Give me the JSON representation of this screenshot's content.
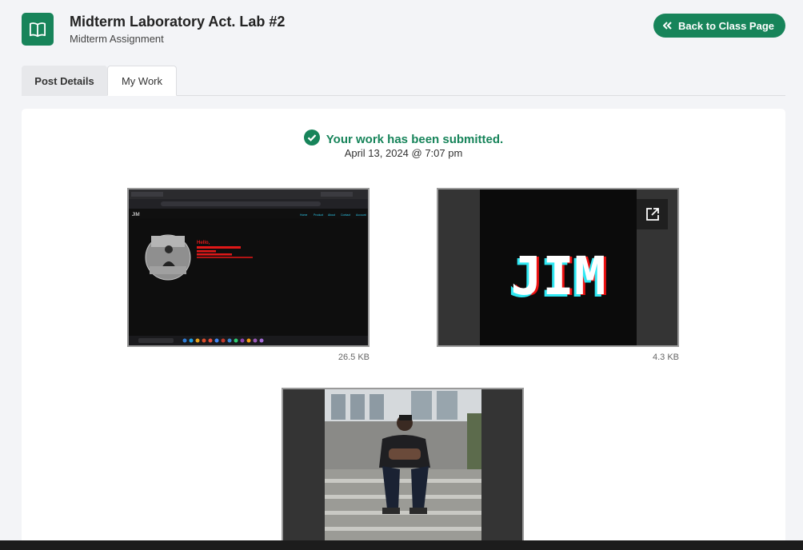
{
  "header": {
    "title": "Midterm Laboratory Act. Lab #2",
    "subtitle": "Midterm Assignment",
    "back_label": "Back to Class Page"
  },
  "tabs": [
    {
      "label": "Post Details",
      "active": false
    },
    {
      "label": "My Work",
      "active": true
    }
  ],
  "submission": {
    "status": "Your work has been submitted.",
    "date": "April 13, 2024 @ 7:07 pm"
  },
  "attachments": [
    {
      "name": "screenshot",
      "size": "26.5 KB"
    },
    {
      "name": "jim-logo",
      "size": "4.3 KB",
      "logo_text": "JIM"
    },
    {
      "name": "photo"
    }
  ],
  "screenshot_page": {
    "logo": "JIM",
    "nav": [
      "Home",
      "Product",
      "About",
      "Contact",
      "Account"
    ],
    "hello": "Hello,"
  },
  "colors": {
    "primary": "#17845a",
    "page_bg": "#f3f4f7"
  }
}
